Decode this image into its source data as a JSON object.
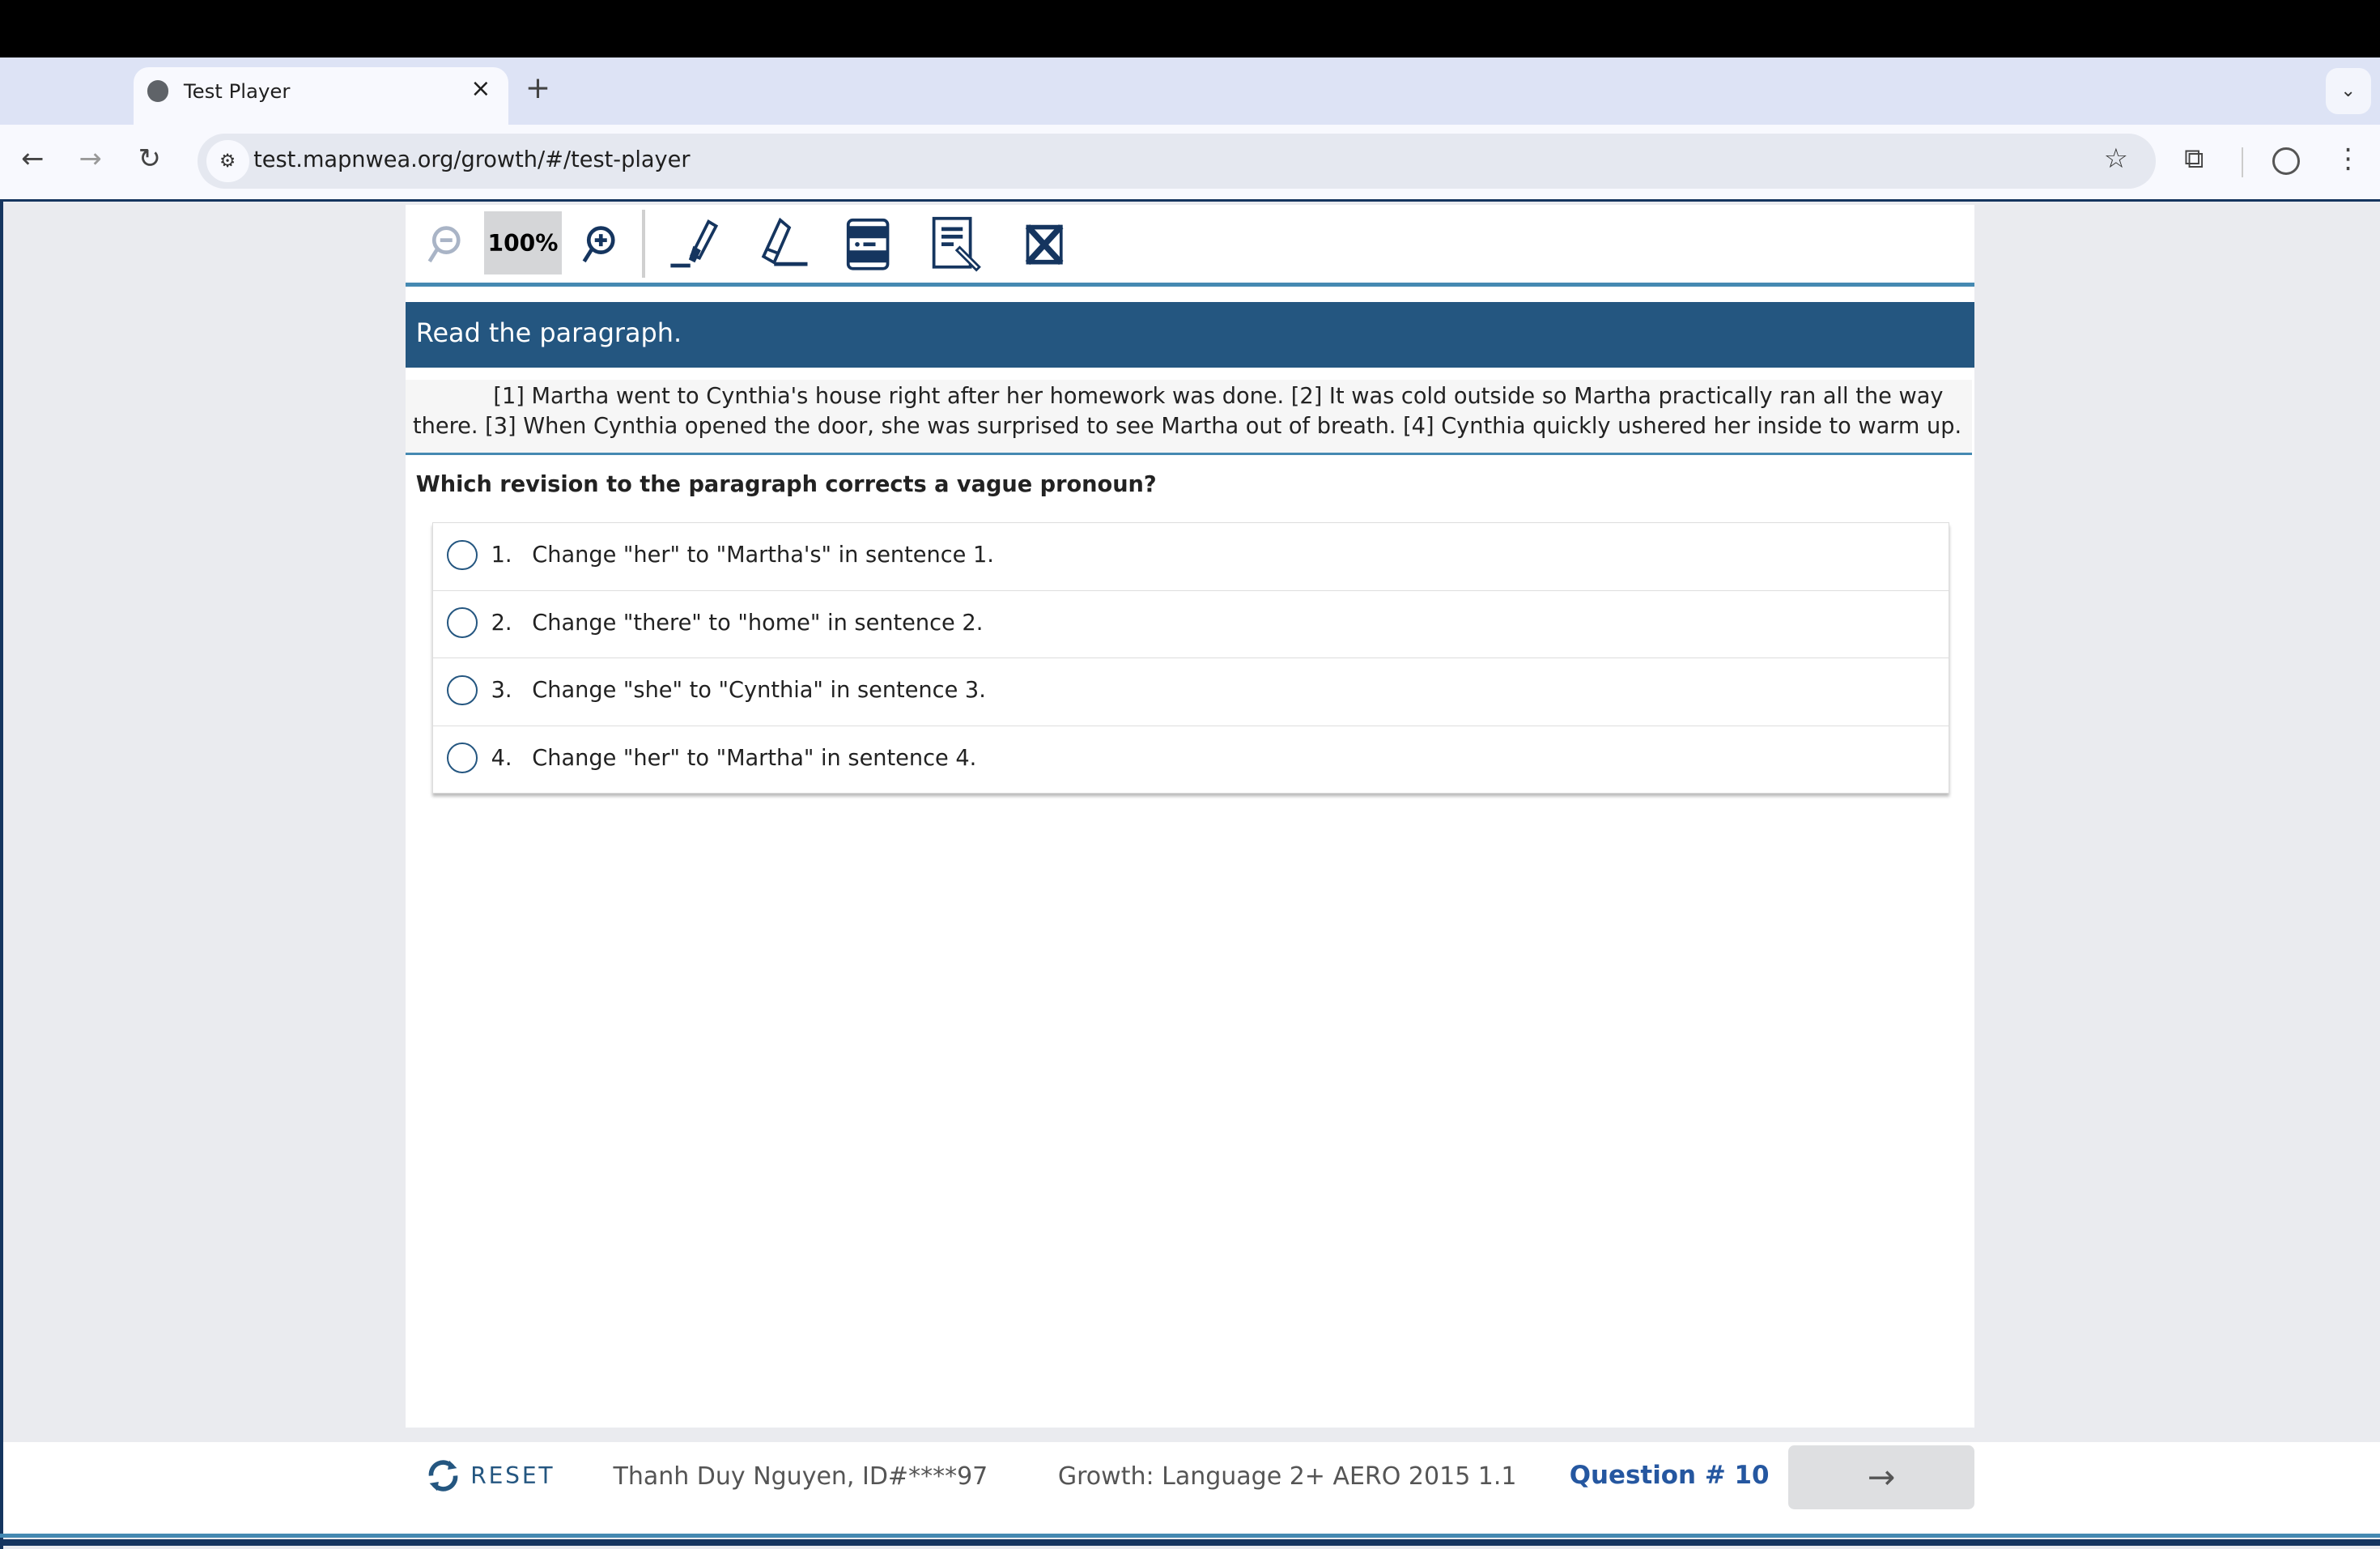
{
  "browser": {
    "tab_title": "Test Player",
    "close_label": "×",
    "new_tab_label": "+",
    "url": "test.mapnwea.org/growth/#/test-player"
  },
  "tools": {
    "zoom_level": "100%"
  },
  "item": {
    "header": "Read the paragraph.",
    "paragraph": "[1] Martha went to Cynthia's house right after her homework was done. [2] It was cold outside so Martha practically ran all the way there. [3] When Cynthia opened the door, she was surprised to see Martha out of breath. [4] Cynthia quickly ushered her inside to warm up.",
    "question": "Which revision to the paragraph corrects a vague pronoun?",
    "options": [
      {
        "num": "1.",
        "text": "Change \"her\" to \"Martha's\" in sentence 1."
      },
      {
        "num": "2.",
        "text": "Change \"there\" to \"home\" in sentence 2."
      },
      {
        "num": "3.",
        "text": "Change \"she\" to \"Cynthia\" in sentence 3."
      },
      {
        "num": "4.",
        "text": "Change \"her\" to \"Martha\" in sentence 4."
      }
    ]
  },
  "footer": {
    "reset_label": "RESET",
    "student": "Thanh Duy Nguyen, ID#****97",
    "test_name": "Growth: Language 2+ AERO 2015 1.1",
    "question_number": "Question # 10",
    "next_label": "→"
  },
  "colors": {
    "primary": "#245680",
    "accent": "#4589b2",
    "dark": "#15355f",
    "link": "#2557a0"
  }
}
